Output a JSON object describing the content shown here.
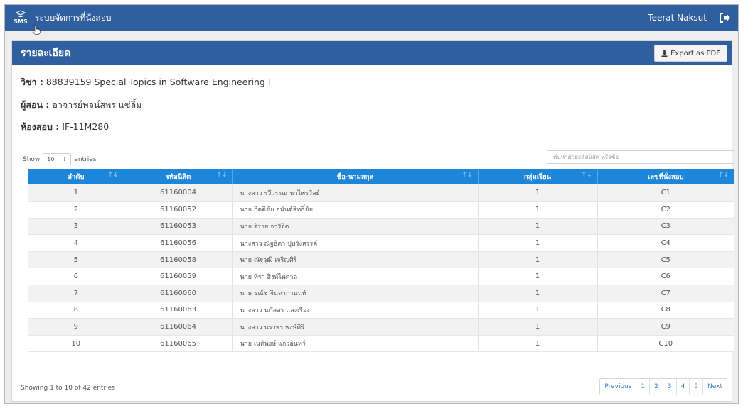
{
  "topbar": {
    "logo_text": "SMS",
    "app_title": "ระบบจัดการที่นั่งสอบ",
    "user_name": "Teerat Naksut",
    "logout_icon": "logout-icon"
  },
  "panel": {
    "title": "รายละเอียด",
    "export_label": "Export as PDF"
  },
  "details": {
    "course_label": "วิชา :",
    "course_value": "88839159 Special Topics in Software Engineering I",
    "instructor_label": "ผู้สอน :",
    "instructor_value": "อาจารย์พจน์สพร แซ่ลิ้ม",
    "room_label": "ห้องสอบ :",
    "room_value": "IF-11M280"
  },
  "table_controls": {
    "show_label": "Show",
    "page_length": "10",
    "entries_label": "entries",
    "search_placeholder": "ค้นหาด้วยรหัสนิสิต หรือชื่อ"
  },
  "table": {
    "columns": [
      "ลำดับ",
      "รหัสนิสิต",
      "ชื่อ-นามสกุล",
      "กลุ่มเรียน",
      "เลขที่นั่งสอบ"
    ],
    "rows": [
      [
        "1",
        "61160004",
        "นางสาว รวีวรรณ นาไพรวัลย์",
        "1",
        "C1"
      ],
      [
        "2",
        "61160052",
        "นาย กิตติชัย อนันต์สิทธิ์ชัย",
        "1",
        "C2"
      ],
      [
        "3",
        "61160053",
        "นาย จิราย จารีจิต",
        "1",
        "C3"
      ],
      [
        "4",
        "61160056",
        "นางสาว ณัฐธิดา ปุษรังสรรค์",
        "1",
        "C4"
      ],
      [
        "5",
        "61160058",
        "นาย ณัฐวุฒิ เจริญศิริ",
        "1",
        "C5"
      ],
      [
        "6",
        "61160059",
        "นาย ทีรา สิงห์ไพศาล",
        "1",
        "C6"
      ],
      [
        "7",
        "61160060",
        "นาย ธณัช จินดากานนท์",
        "1",
        "C7"
      ],
      [
        "8",
        "61160063",
        "นางสาว นภัสสร แสงเรือง",
        "1",
        "C8"
      ],
      [
        "9",
        "61160064",
        "นางสาว นราพร พงษ์ศิริ",
        "1",
        "C9"
      ],
      [
        "10",
        "61160065",
        "นาย เนติพงษ์ แก้วอินทร์",
        "1",
        "C10"
      ]
    ]
  },
  "footer": {
    "showing_text": "Showing 1 to 10 of 42 entries",
    "pagination": [
      "Previous",
      "1",
      "2",
      "3",
      "4",
      "5",
      "Next"
    ]
  },
  "colors": {
    "header_blue": "#2f5f9e",
    "table_head_blue": "#1e86d8",
    "link_blue": "#3a7fc4"
  }
}
